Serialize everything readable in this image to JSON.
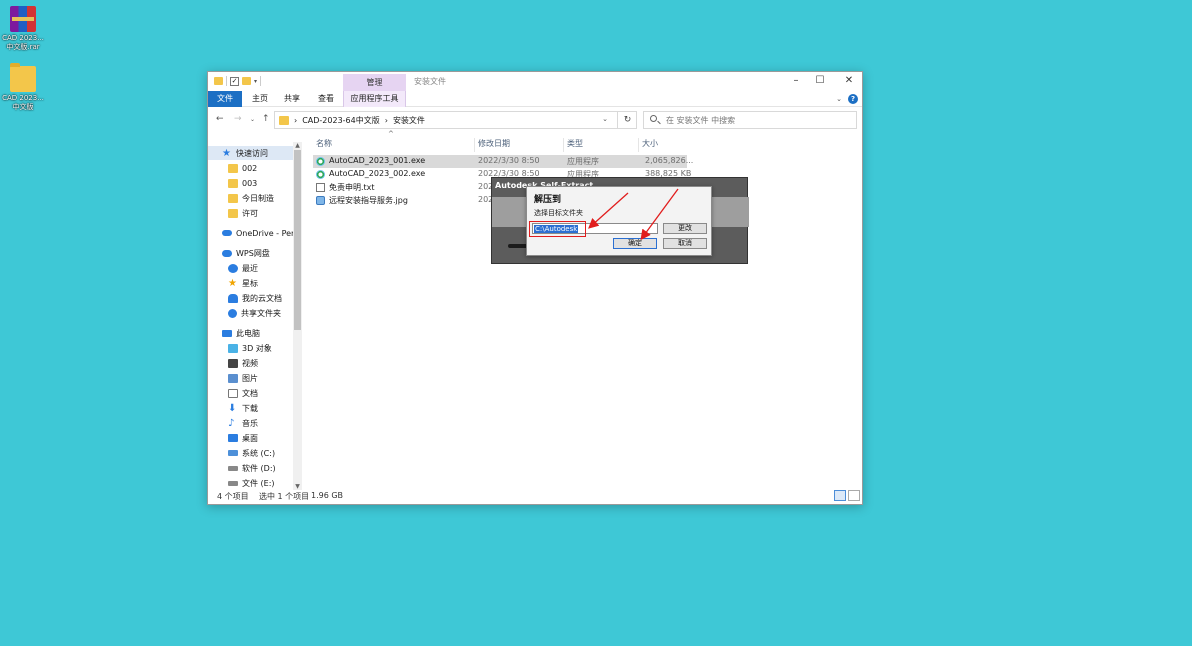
{
  "desktop": {
    "icons": [
      {
        "label_line1": "CAD 2023...",
        "label_line2": "中文版.rar",
        "icon": "winrar-archive-icon"
      },
      {
        "label_line1": "CAD 2023...",
        "label_line2": "中文版",
        "icon": "folder-icon"
      }
    ]
  },
  "window": {
    "title": "安装文件",
    "ribbon": {
      "context_group": "管理",
      "tabs": [
        "文件",
        "主页",
        "共享",
        "查看",
        "应用程序工具"
      ]
    },
    "address": {
      "crumbs": [
        "CAD-2023-64中文版",
        "安装文件"
      ]
    },
    "search": {
      "placeholder": "在 安装文件 中搜索"
    },
    "nav": {
      "items": [
        {
          "label": "快速访问",
          "icon": "star-icon"
        },
        {
          "label": "002",
          "icon": "folder-icon"
        },
        {
          "label": "003",
          "icon": "folder-icon"
        },
        {
          "label": "今日制造",
          "icon": "folder-icon"
        },
        {
          "label": "许可",
          "icon": "folder-icon"
        },
        {
          "label": "OneDrive - Pers",
          "icon": "onedrive-icon"
        },
        {
          "label": "WPS网盘",
          "icon": "wps-cloud-icon"
        },
        {
          "label": "最近",
          "icon": "clock-icon"
        },
        {
          "label": "星标",
          "icon": "star-icon"
        },
        {
          "label": "我的云文档",
          "icon": "cloud-docs-icon"
        },
        {
          "label": "共享文件夹",
          "icon": "shared-folder-icon"
        },
        {
          "label": "此电脑",
          "icon": "this-pc-icon"
        },
        {
          "label": "3D 对象",
          "icon": "3d-objects-icon"
        },
        {
          "label": "视频",
          "icon": "video-icon"
        },
        {
          "label": "图片",
          "icon": "pictures-icon"
        },
        {
          "label": "文档",
          "icon": "documents-icon"
        },
        {
          "label": "下载",
          "icon": "download-icon"
        },
        {
          "label": "音乐",
          "icon": "music-icon"
        },
        {
          "label": "桌面",
          "icon": "desktop-icon"
        },
        {
          "label": "系统 (C:)",
          "icon": "drive-c-icon"
        },
        {
          "label": "软件 (D:)",
          "icon": "drive-icon"
        },
        {
          "label": "文件 (E:)",
          "icon": "drive-icon"
        }
      ]
    },
    "columns": [
      "名称",
      "修改日期",
      "类型",
      "大小"
    ],
    "files": [
      {
        "name": "AutoCAD_2023_001.exe",
        "date": "2022/3/30 8:50",
        "type": "应用程序",
        "size": "2,065,826...",
        "icon": "exe-icon"
      },
      {
        "name": "AutoCAD_2023_002.exe",
        "date": "2022/3/30 8:50",
        "type": "应用程序",
        "size": "388,825 KB",
        "icon": "exe-icon"
      },
      {
        "name": "免责申明.txt",
        "date": "202",
        "type": "",
        "size": "",
        "icon": "txt-icon"
      },
      {
        "name": "远程安装指导服务.jpg",
        "date": "202",
        "type": "",
        "size": "",
        "icon": "jpg-icon"
      }
    ],
    "status": {
      "count": "4 个项目",
      "selection": "选中 1 个项目",
      "size": "1.96 GB"
    }
  },
  "sfx_dialog": {
    "title": "Autodesk Self-Extract"
  },
  "extract_dialog": {
    "title": "解压到",
    "label": "选择目标文件夹",
    "path_value": "C:\\Autodesk",
    "change_label": "更改",
    "ok_label": "确定",
    "cancel_label": "取消"
  },
  "colors": {
    "desktop_bg": "#3ec8d6",
    "file_tab": "#1c6fc4",
    "context_tab": "#e6d4f2",
    "annotation": "#e11d1d"
  }
}
